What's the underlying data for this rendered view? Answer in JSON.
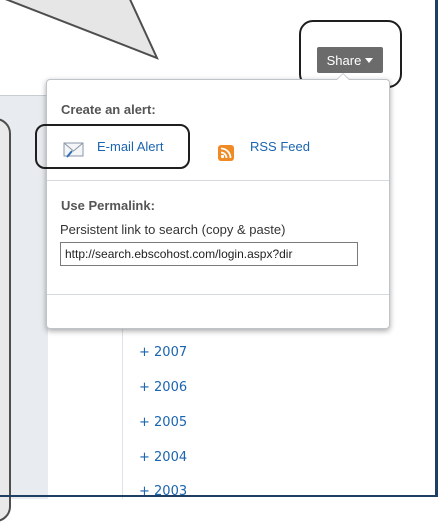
{
  "share_button": {
    "label": "Share"
  },
  "popover": {
    "alert_title": "Create an alert:",
    "email_alert": "E-mail Alert",
    "rss_feed": "RSS Feed",
    "permalink_title": "Use Permalink:",
    "permalink_desc": "Persistent link to search (copy & paste)",
    "permalink_value": "http://search.ebscohost.com/login.aspx?dir"
  },
  "years": [
    "+ 2007",
    "+ 2006",
    "+ 2005",
    "+ 2004",
    "+ 2003"
  ],
  "colors": {
    "link": "#1a64b0",
    "share_bg": "#6b6b6b",
    "rss": "#f08a24",
    "frame": "#1d3f63"
  }
}
